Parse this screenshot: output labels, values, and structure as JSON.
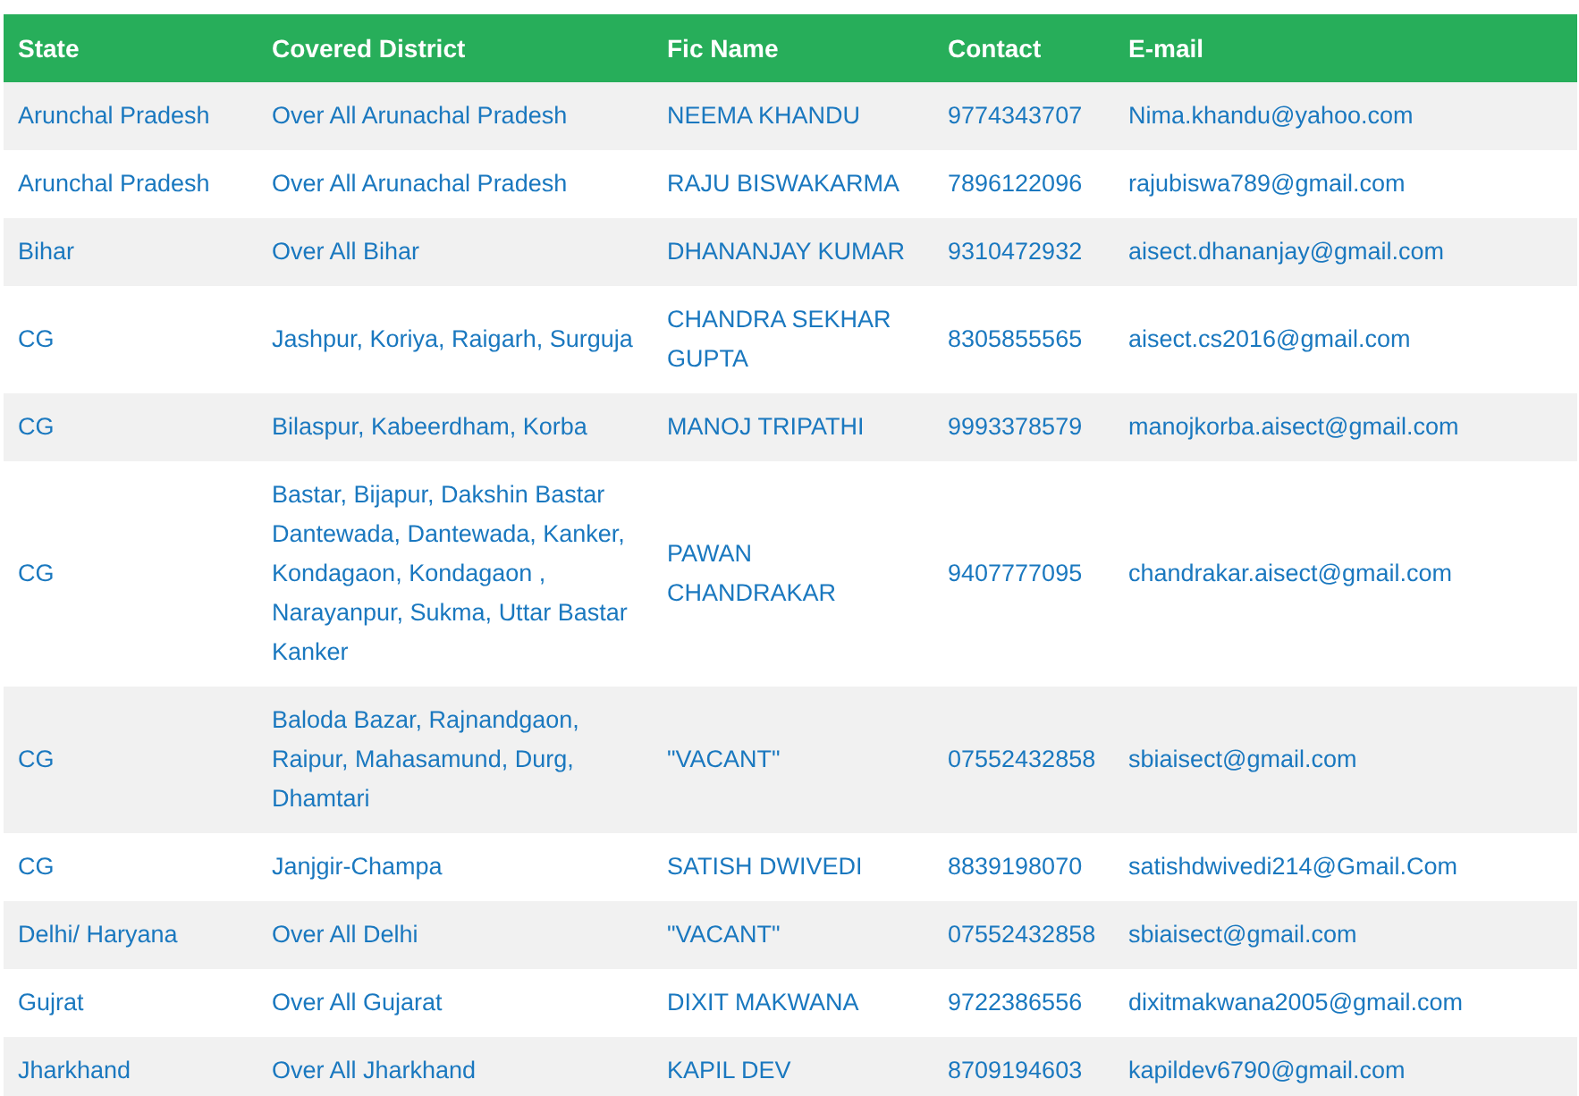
{
  "table": {
    "columns": [
      "State",
      "Covered District",
      "Fic Name",
      "Contact",
      "E-mail"
    ],
    "rows": [
      [
        "Arunchal Pradesh",
        "Over All Arunachal Pradesh",
        "NEEMA KHANDU",
        "9774343707",
        "Nima.khandu@yahoo.com"
      ],
      [
        "Arunchal Pradesh",
        "Over All Arunachal Pradesh",
        "RAJU BISWAKARMA",
        "7896122096",
        "rajubiswa789@gmail.com"
      ],
      [
        "Bihar",
        "Over All Bihar",
        "DHANANJAY KUMAR",
        "9310472932",
        "aisect.dhananjay@gmail.com"
      ],
      [
        "CG",
        "Jashpur, Koriya, Raigarh, Surguja",
        "CHANDRA SEKHAR GUPTA",
        "8305855565",
        "aisect.cs2016@gmail.com"
      ],
      [
        "CG",
        "Bilaspur, Kabeerdham, Korba",
        "MANOJ TRIPATHI",
        "9993378579",
        "manojkorba.aisect@gmail.com"
      ],
      [
        "CG",
        "Bastar, Bijapur, Dakshin Bastar Dantewada, Dantewada, Kanker, Kondagaon, Kondagaon , Narayanpur, Sukma, Uttar Bastar Kanker",
        "PAWAN CHANDRAKAR",
        "9407777095",
        "chandrakar.aisect@gmail.com"
      ],
      [
        "CG",
        "Baloda Bazar, Rajnandgaon, Raipur, Mahasamund, Durg, Dhamtari",
        "\"VACANT\"",
        "07552432858",
        "sbiaisect@gmail.com"
      ],
      [
        "CG",
        "Janjgir-Champa",
        "SATISH DWIVEDI",
        "8839198070",
        "satishdwivedi214@Gmail.Com"
      ],
      [
        "Delhi/ Haryana",
        "Over All Delhi",
        "\"VACANT\"",
        "07552432858",
        "sbiaisect@gmail.com"
      ],
      [
        "Gujrat",
        "Over All Gujarat",
        "DIXIT MAKWANA",
        "9722386556",
        "dixitmakwana2005@gmail.com"
      ],
      [
        "Jharkhand",
        "Over All Jharkhand",
        "KAPIL DEV",
        "8709194603",
        "kapildev6790@gmail.com"
      ]
    ]
  }
}
